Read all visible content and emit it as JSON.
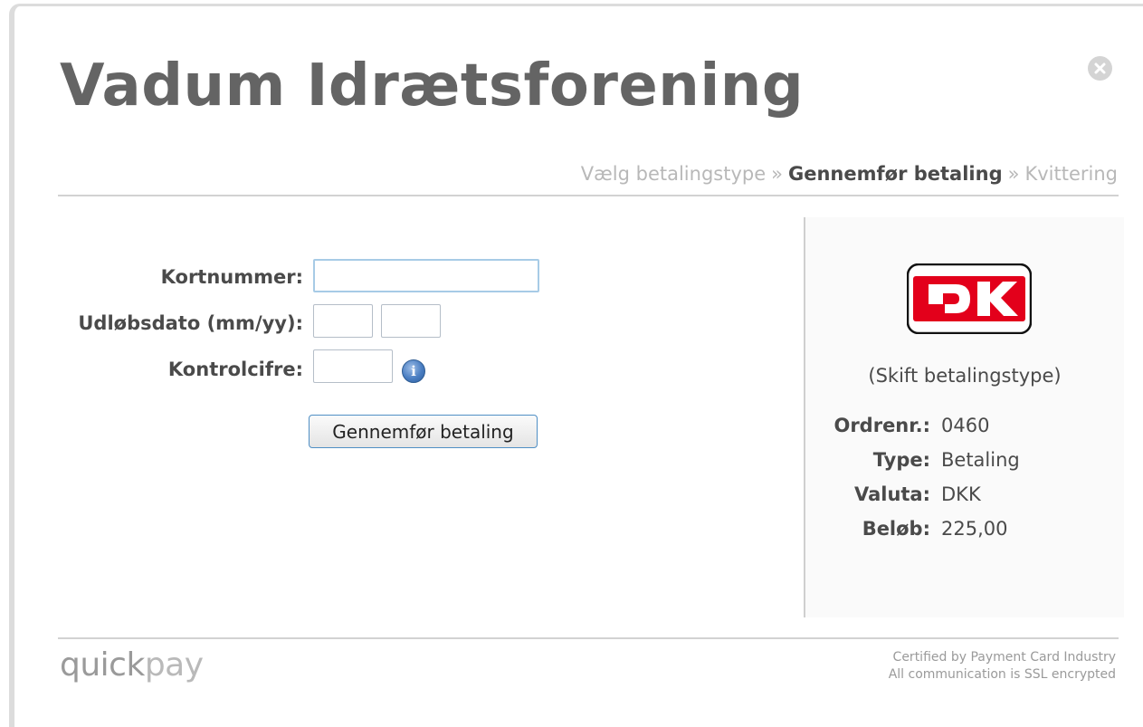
{
  "header": {
    "title": "Vadum Idrætsforening"
  },
  "steps": {
    "items": [
      {
        "label": "Vælg betalingstype",
        "active": false
      },
      {
        "label": "Gennemfør betaling",
        "active": true
      },
      {
        "label": "Kvittering",
        "active": false
      }
    ],
    "separator": "»"
  },
  "form": {
    "card_number_label": "Kortnummer:",
    "card_number_value": "",
    "expiry_label": "Udløbsdato (mm/yy):",
    "expiry_month_value": "",
    "expiry_year_value": "",
    "cvc_label": "Kontrolcifre:",
    "cvc_value": "",
    "submit_label": "Gennemfør betaling"
  },
  "payment_method": {
    "logo_text": "DK",
    "switch_label": "(Skift betalingstype)"
  },
  "summary": {
    "rows": [
      {
        "label": "Ordrenr.:",
        "value": "0460"
      },
      {
        "label": "Type:",
        "value": "Betaling"
      },
      {
        "label": "Valuta:",
        "value": "DKK"
      },
      {
        "label": "Beløb:",
        "value": "225,00"
      }
    ]
  },
  "footer": {
    "logo_dark": "quick",
    "logo_light": "pay",
    "cert_line1": "Certified by Payment Card Industry",
    "cert_line2": "All communication is SSL encrypted"
  },
  "colors": {
    "title": "#646464",
    "text": "#4a4a4a",
    "muted": "#b8b8b8",
    "dk_red": "#e3001b",
    "button_border": "#4f8fc5"
  }
}
